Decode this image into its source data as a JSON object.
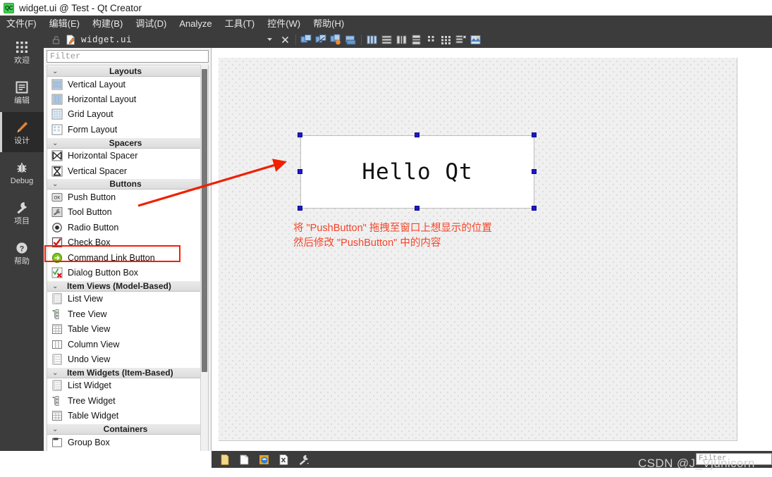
{
  "window": {
    "title": "widget.ui @ Test - Qt Creator",
    "app_icon": "qt-creator-icon",
    "icon_text": "QC"
  },
  "menubar": {
    "items": [
      {
        "label": "文件(F)",
        "mnemonic": "F"
      },
      {
        "label": "编辑(E)",
        "mnemonic": "E"
      },
      {
        "label": "构建(B)",
        "mnemonic": "B"
      },
      {
        "label": "调试(D)",
        "mnemonic": "D"
      },
      {
        "label": "Analyze",
        "mnemonic": "A"
      },
      {
        "label": "工具(T)",
        "mnemonic": "T"
      },
      {
        "label": "控件(W)",
        "mnemonic": "W"
      },
      {
        "label": "帮助(H)",
        "mnemonic": "H"
      }
    ]
  },
  "mode_rail": {
    "items": [
      {
        "label": "欢迎",
        "icon": "grid-dots-icon",
        "active": false
      },
      {
        "label": "编辑",
        "icon": "document-icon",
        "active": false
      },
      {
        "label": "设计",
        "icon": "pencil-icon",
        "active": true
      },
      {
        "label": "Debug",
        "icon": "bug-icon",
        "active": false
      },
      {
        "label": "项目",
        "icon": "wrench-icon",
        "active": false
      },
      {
        "label": "帮助",
        "icon": "question-circle-icon",
        "active": false
      }
    ]
  },
  "docbar": {
    "lock_icon": "lock-open-icon",
    "file_icon": "ui-file-icon",
    "filename": "widget.ui",
    "dropdown_icon": "chevron-down-icon",
    "close_icon": "close-icon",
    "tools": [
      {
        "name": "edit-widgets-icon"
      },
      {
        "name": "edit-signals-slots-icon"
      },
      {
        "name": "edit-buddies-icon"
      },
      {
        "name": "edit-tab-order-icon"
      },
      {
        "name": "layout-horizontally-icon"
      },
      {
        "name": "layout-vertically-icon"
      },
      {
        "name": "layout-splitter-horizontal-icon"
      },
      {
        "name": "layout-splitter-vertical-icon"
      },
      {
        "name": "layout-form-icon"
      },
      {
        "name": "layout-grid-icon"
      },
      {
        "name": "break-layout-icon"
      },
      {
        "name": "adjust-size-icon"
      }
    ]
  },
  "widget_box": {
    "filter_placeholder": "Filter",
    "filter_value": "",
    "scrollbar": "vertical-scrollbar",
    "highlight": {
      "target": "Push Button",
      "color": "#ff1a00"
    },
    "groups": [
      {
        "name": "Layouts",
        "align": "center",
        "expanded": true,
        "items": [
          {
            "label": "Vertical Layout",
            "icon": "vertical-layout-icon"
          },
          {
            "label": "Horizontal Layout",
            "icon": "horizontal-layout-icon"
          },
          {
            "label": "Grid Layout",
            "icon": "grid-layout-icon"
          },
          {
            "label": "Form Layout",
            "icon": "form-layout-icon"
          }
        ]
      },
      {
        "name": "Spacers",
        "align": "center",
        "expanded": true,
        "items": [
          {
            "label": "Horizontal Spacer",
            "icon": "horizontal-spacer-icon"
          },
          {
            "label": "Vertical Spacer",
            "icon": "vertical-spacer-icon"
          }
        ]
      },
      {
        "name": "Buttons",
        "align": "center",
        "expanded": true,
        "items": [
          {
            "label": "Push Button",
            "icon": "push-button-icon"
          },
          {
            "label": "Tool Button",
            "icon": "tool-button-icon"
          },
          {
            "label": "Radio Button",
            "icon": "radio-button-icon"
          },
          {
            "label": "Check Box",
            "icon": "check-box-icon"
          },
          {
            "label": "Command Link Button",
            "icon": "command-link-button-icon"
          },
          {
            "label": "Dialog Button Box",
            "icon": "dialog-button-box-icon"
          }
        ]
      },
      {
        "name": "Item Views (Model-Based)",
        "align": "left",
        "expanded": true,
        "items": [
          {
            "label": "List View",
            "icon": "list-view-icon"
          },
          {
            "label": "Tree View",
            "icon": "tree-view-icon"
          },
          {
            "label": "Table View",
            "icon": "table-view-icon"
          },
          {
            "label": "Column View",
            "icon": "column-view-icon"
          },
          {
            "label": "Undo View",
            "icon": "undo-view-icon"
          }
        ]
      },
      {
        "name": "Item Widgets (Item-Based)",
        "align": "left",
        "expanded": true,
        "items": [
          {
            "label": "List Widget",
            "icon": "list-widget-icon"
          },
          {
            "label": "Tree Widget",
            "icon": "tree-widget-icon"
          },
          {
            "label": "Table Widget",
            "icon": "table-widget-icon"
          }
        ]
      },
      {
        "name": "Containers",
        "align": "center",
        "expanded": true,
        "items": [
          {
            "label": "Group Box",
            "icon": "group-box-icon"
          }
        ]
      }
    ]
  },
  "canvas": {
    "selected_widget": {
      "name": "pushButton",
      "text": "Hello Qt",
      "selected": true,
      "handle_color": "#1d18c8"
    },
    "annotation": {
      "color": "#f6452a",
      "line1": "将 \"PushButton\" 拖拽至窗口上想显示的位置",
      "line2": "然后修改 \"PushButton\" 中的内容",
      "arrow": "red-arrow-pointer"
    }
  },
  "bottom_bar": {
    "icons": [
      {
        "name": "issues-icon"
      },
      {
        "name": "search-results-icon"
      },
      {
        "name": "application-output-icon"
      },
      {
        "name": "compile-output-icon"
      },
      {
        "name": "build-settings-icon"
      }
    ],
    "filter_placeholder": "Filter",
    "filter_value": ""
  },
  "watermark": {
    "text": "CSDN @J_Vjunicorn"
  }
}
